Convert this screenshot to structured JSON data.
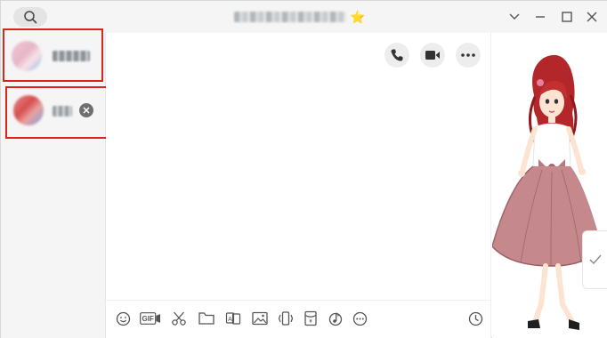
{
  "window": {
    "title_star": "⭐"
  },
  "icons": {
    "search": "search-icon",
    "minimize": "chevron-down-icon",
    "underline_min": "minimize-icon",
    "maximize": "maximize-icon",
    "close": "close-icon"
  },
  "conversations": [
    {
      "avatar_colors": [
        "#e7b6c6",
        "#f4d8df",
        "#9fb7e0"
      ],
      "selected_marker": true
    },
    {
      "avatar_colors": [
        "#d84f4f",
        "#e9a0a0",
        "#7aa2e0"
      ],
      "has_close": true
    }
  ],
  "chat_header_actions": [
    "phone-icon",
    "video-icon",
    "more-icon"
  ],
  "composer_tools": [
    "emoji-icon",
    "gif-icon",
    "scissors-icon",
    "folder-icon",
    "sticker-icon",
    "image-icon",
    "shake-icon",
    "red-packet-icon",
    "music-icon",
    "more-circle-icon",
    "history-clock-icon"
  ],
  "gif_label": "GIF",
  "colors": {
    "highlight_border": "#d9261c",
    "sidebar_bg": "#f5f5f5",
    "icon_gray": "#555555"
  }
}
